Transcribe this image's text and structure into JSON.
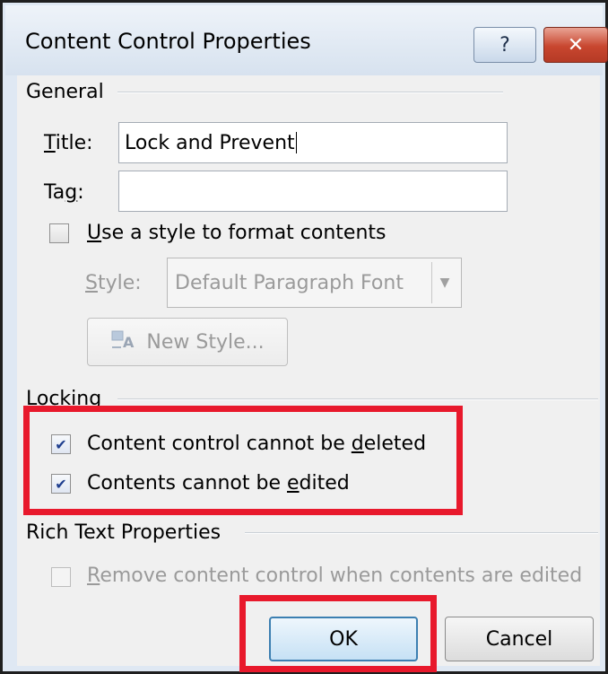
{
  "window": {
    "title": "Content Control Properties",
    "help_glyph": "?",
    "close_glyph": "✕"
  },
  "general": {
    "section_label": "General",
    "title_label": "Title:",
    "title_value": "Lock and Prevent",
    "tag_label": "Tag:",
    "tag_value": "",
    "use_style_label": "Use a style to format contents",
    "use_style_checked": false,
    "style_label": "Style:",
    "style_value": "Default Paragraph Font",
    "new_style_label": "New Style..."
  },
  "locking": {
    "section_label": "Locking",
    "cannot_delete_label": "Content control cannot be deleted",
    "cannot_delete_checked": true,
    "cannot_edit_label": "Contents cannot be edited",
    "cannot_edit_checked": true
  },
  "rich_text": {
    "section_label": "Rich Text Properties",
    "remove_label": "Remove content control when contents are edited",
    "remove_checked": false
  },
  "buttons": {
    "ok_label": "OK",
    "cancel_label": "Cancel"
  },
  "colors": {
    "highlight": "#e8192c",
    "close_button": "#c8462f",
    "checkmark": "#1f3f8f"
  },
  "icons": {
    "new_style": "new-style-icon",
    "dropdown": "chevron-down-icon"
  }
}
